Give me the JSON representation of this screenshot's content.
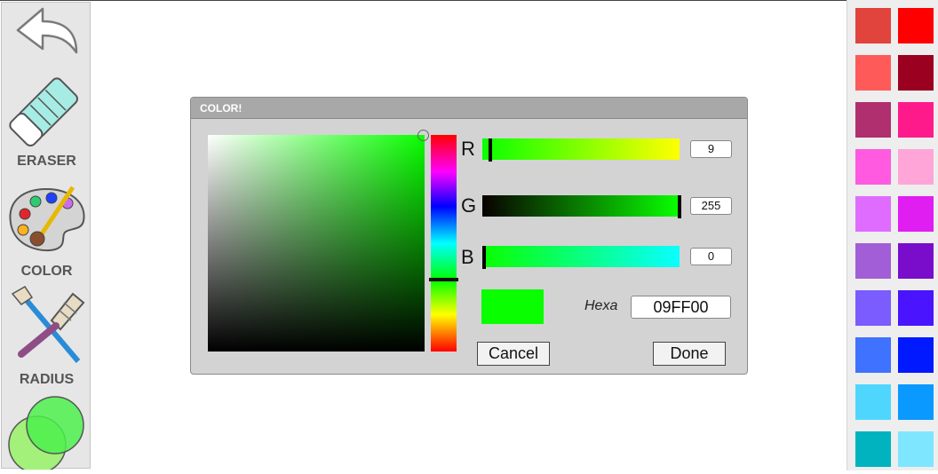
{
  "toolbar": {
    "back_icon": "back-arrow-icon",
    "eraser_label": "ERASER",
    "color_label": "COLOR",
    "radius_label": "RADIUS"
  },
  "dialog": {
    "title": "COLOR!",
    "r_label": "R",
    "g_label": "G",
    "b_label": "B",
    "r_value": "9",
    "g_value": "255",
    "b_value": "0",
    "hexa_label": "Hexa",
    "hexa_value": "09FF00",
    "selected_color": "#09ff00",
    "cancel_label": "Cancel",
    "done_label": "Done"
  },
  "palette": [
    [
      "#e0443c",
      "#ff0000"
    ],
    [
      "#ff5a5a",
      "#9b0020"
    ],
    [
      "#b02f6e",
      "#ff1a8c"
    ],
    [
      "#ff5ae0",
      "#ffa5d8"
    ],
    [
      "#e06cff",
      "#e01ef2"
    ],
    [
      "#a25ed6",
      "#7a0ccc"
    ],
    [
      "#7a5cff",
      "#4a14ff"
    ],
    [
      "#3f72ff",
      "#0019ff"
    ],
    [
      "#4fd6ff",
      "#0a99ff"
    ],
    [
      "#00b3bf",
      "#7fe6ff"
    ]
  ]
}
